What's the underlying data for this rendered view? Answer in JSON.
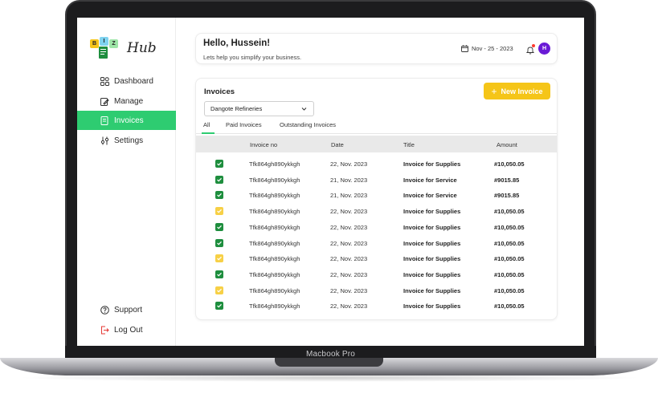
{
  "device": {
    "label": "Macbook Pro"
  },
  "brand": {
    "logo_letters": [
      "B",
      "I",
      "Z"
    ],
    "name": "Hub"
  },
  "sidebar": {
    "items": [
      {
        "label": "Dashboard",
        "icon": "dashboard-icon"
      },
      {
        "label": "Manage",
        "icon": "manage-icon"
      },
      {
        "label": "Invoices",
        "icon": "invoice-icon",
        "active": true
      },
      {
        "label": "Settings",
        "icon": "settings-icon"
      }
    ],
    "bottom": [
      {
        "label": "Support",
        "icon": "help-icon"
      },
      {
        "label": "Log Out",
        "icon": "logout-icon"
      }
    ]
  },
  "header": {
    "greeting": "Hello, Hussein!",
    "subtitle": "Lets help you simplify your business.",
    "date": "Nov - 25 - 2023",
    "avatar_initial": "H"
  },
  "invoices": {
    "title": "Invoices",
    "new_button": "New Invoice",
    "company_select": "Dangote Refineries",
    "tabs": [
      "All",
      "Paid Invoices",
      "Outstanding Invoices"
    ],
    "columns": [
      "Invoice no",
      "Date",
      "Title",
      "Amount"
    ],
    "rows": [
      {
        "status": "green",
        "invoice_no": "Tfk864gh890ykkgh",
        "date": "22, Nov. 2023",
        "title": "Invoice for Supplies",
        "amount": "#10,050.05"
      },
      {
        "status": "green",
        "invoice_no": "Tfk864gh890ykkgh",
        "date": "21, Nov. 2023",
        "title": "Invoice for Service",
        "amount": "#9015.85"
      },
      {
        "status": "green",
        "invoice_no": "Tfk864gh890ykkgh",
        "date": "21, Nov. 2023",
        "title": "Invoice for Service",
        "amount": "#9015.85"
      },
      {
        "status": "yellow",
        "invoice_no": "Tfk864gh890ykkgh",
        "date": "22, Nov. 2023",
        "title": "Invoice for Supplies",
        "amount": "#10,050.05"
      },
      {
        "status": "green",
        "invoice_no": "Tfk864gh890ykkgh",
        "date": "22, Nov. 2023",
        "title": "Invoice for Supplies",
        "amount": "#10,050.05"
      },
      {
        "status": "green",
        "invoice_no": "Tfk864gh890ykkgh",
        "date": "22, Nov. 2023",
        "title": "Invoice for Supplies",
        "amount": "#10,050.05"
      },
      {
        "status": "yellow",
        "invoice_no": "Tfk864gh890ykkgh",
        "date": "22, Nov. 2023",
        "title": "Invoice for Supplies",
        "amount": "#10,050.05"
      },
      {
        "status": "green",
        "invoice_no": "Tfk864gh890ykkgh",
        "date": "22, Nov. 2023",
        "title": "Invoice for Supplies",
        "amount": "#10,050.05"
      },
      {
        "status": "yellow",
        "invoice_no": "Tfk864gh890ykkgh",
        "date": "22, Nov. 2023",
        "title": "Invoice for Supplies",
        "amount": "#10,050.05"
      },
      {
        "status": "green",
        "invoice_no": "Tfk864gh890ykkgh",
        "date": "22, Nov. 2023",
        "title": "Invoice for Supplies",
        "amount": "#10,050.05"
      }
    ]
  },
  "colors": {
    "accent_green": "#2ecc71",
    "accent_yellow": "#f5c518",
    "avatar_purple": "#6a1bd6",
    "status_green": "#1e8e3e",
    "status_yellow": "#f7d046"
  }
}
